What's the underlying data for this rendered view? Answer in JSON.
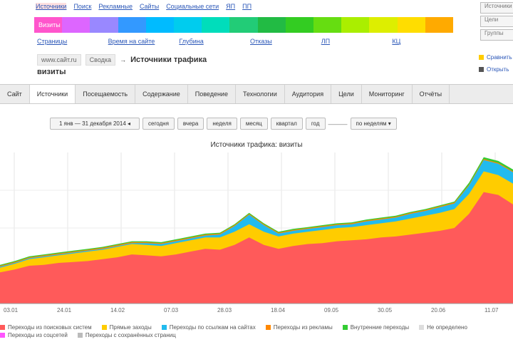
{
  "top_links": [
    "Источники",
    "Поиск",
    "Рекламные",
    "Сайты",
    "Социальные сети",
    "ЯП",
    "ПП"
  ],
  "spectrum": {
    "label": "Визиты",
    "colors": [
      "#ff55cc",
      "#dd66ff",
      "#9988ff",
      "#3399ff",
      "#00bbff",
      "#00ccee",
      "#00ddbb",
      "#22cc77",
      "#22bb44",
      "#33cc22",
      "#66dd11",
      "#aaee00",
      "#ddee00",
      "#ffdd00",
      "#ffaa00"
    ],
    "links": [
      "Страницы",
      "Время на сайте",
      "Глубина",
      "Отказы",
      "ЛП",
      "КЦ"
    ]
  },
  "right_tabs": [
    "Источники",
    "Цели",
    "Группы"
  ],
  "breadcrumb": {
    "parts": [
      "www.сайт.ru",
      "Сводка"
    ],
    "arrow": "→",
    "title": "Источники трафика",
    "title_line2": "визиты"
  },
  "legend_right": [
    {
      "label": "Сравнить",
      "color": "#ffcc00"
    },
    {
      "label": "Открыть",
      "color": "#555555"
    }
  ],
  "nav_tabs": [
    "Сайт",
    "Источники",
    "Посещаемость",
    "Содержание",
    "Поведение",
    "Технологии",
    "Аудитория",
    "Цели",
    "Мониторинг",
    "Отчёты"
  ],
  "active_tab": 1,
  "period": {
    "range": "1 янв — 31 декабря 2014 ◂",
    "buttons": [
      "сегодня",
      "вчера",
      "неделя",
      "месяц",
      "квартал",
      "год"
    ],
    "detail": "по неделям ▾"
  },
  "chart_data": {
    "type": "area",
    "title": "Источники трафика: визиты",
    "x": [
      "03.01",
      "24.01",
      "14.02",
      "07.03",
      "28.03",
      "18.04",
      "09.05",
      "30.05",
      "20.06",
      "11.07"
    ],
    "series": [
      {
        "name": "Переходы из поисковых систем",
        "color": "#ff5a5a",
        "values": [
          33,
          36,
          40,
          41,
          43,
          44,
          45,
          47,
          49,
          52,
          51,
          50,
          52,
          55,
          58,
          57,
          62,
          70,
          62,
          58,
          61,
          63,
          64,
          66,
          67,
          68,
          70,
          71,
          73,
          75,
          77,
          80,
          95,
          118,
          115,
          105
        ]
      },
      {
        "name": "Прямые заходы",
        "color": "#ffcc00",
        "values": [
          5,
          6,
          7,
          8,
          8,
          9,
          10,
          10,
          11,
          11,
          11,
          11,
          12,
          12,
          12,
          13,
          14,
          14,
          14,
          13,
          13,
          13,
          14,
          14,
          14,
          15,
          15,
          16,
          17,
          18,
          19,
          20,
          21,
          22,
          21,
          22
        ]
      },
      {
        "name": "Переходы по ссылкам на сайтах",
        "color": "#22bbee",
        "values": [
          1,
          1,
          1,
          1,
          1,
          1,
          1,
          1,
          1,
          1,
          2,
          2,
          2,
          2,
          2,
          3,
          6,
          10,
          7,
          3,
          3,
          3,
          3,
          3,
          3,
          4,
          4,
          4,
          5,
          5,
          6,
          6,
          9,
          12,
          12,
          12
        ]
      },
      {
        "name": "Переходы из рекламы",
        "color": "#ff8800",
        "values": [
          1,
          1,
          1,
          1,
          1,
          1,
          1,
          1,
          1,
          1,
          1,
          1,
          1,
          1,
          1,
          1,
          1,
          1,
          1,
          1,
          1,
          1,
          1,
          1,
          1,
          1,
          1,
          1,
          1,
          1,
          1,
          1,
          1,
          1,
          1,
          1
        ]
      },
      {
        "name": "Внутренние переходы",
        "color": "#33cc33",
        "values": [
          1,
          1,
          1,
          1,
          1,
          1,
          1,
          1,
          1,
          1,
          1,
          1,
          1,
          1,
          1,
          1,
          1,
          1,
          1,
          1,
          1,
          1,
          1,
          1,
          1,
          1,
          1,
          1,
          1,
          1,
          1,
          1,
          2,
          2,
          2,
          2
        ]
      }
    ],
    "ymax": 160,
    "grid": true
  },
  "bottom_legend": [
    {
      "label": "Переходы из поисковых систем",
      "color": "#ff5a5a"
    },
    {
      "label": "Прямые заходы",
      "color": "#ffcc00"
    },
    {
      "label": "Переходы по ссылкам на сайтах",
      "color": "#22bbee"
    },
    {
      "label": "Переходы из рекламы",
      "color": "#ff8800"
    },
    {
      "label": "Внутренние переходы",
      "color": "#33cc33"
    },
    {
      "label": "Не определено",
      "color": "#dddddd"
    },
    {
      "label": "Переходы из соцсетей",
      "color": "#ff55ff"
    },
    {
      "label": "Переходы с сохранённых страниц",
      "color": "#bbbbbb"
    }
  ]
}
